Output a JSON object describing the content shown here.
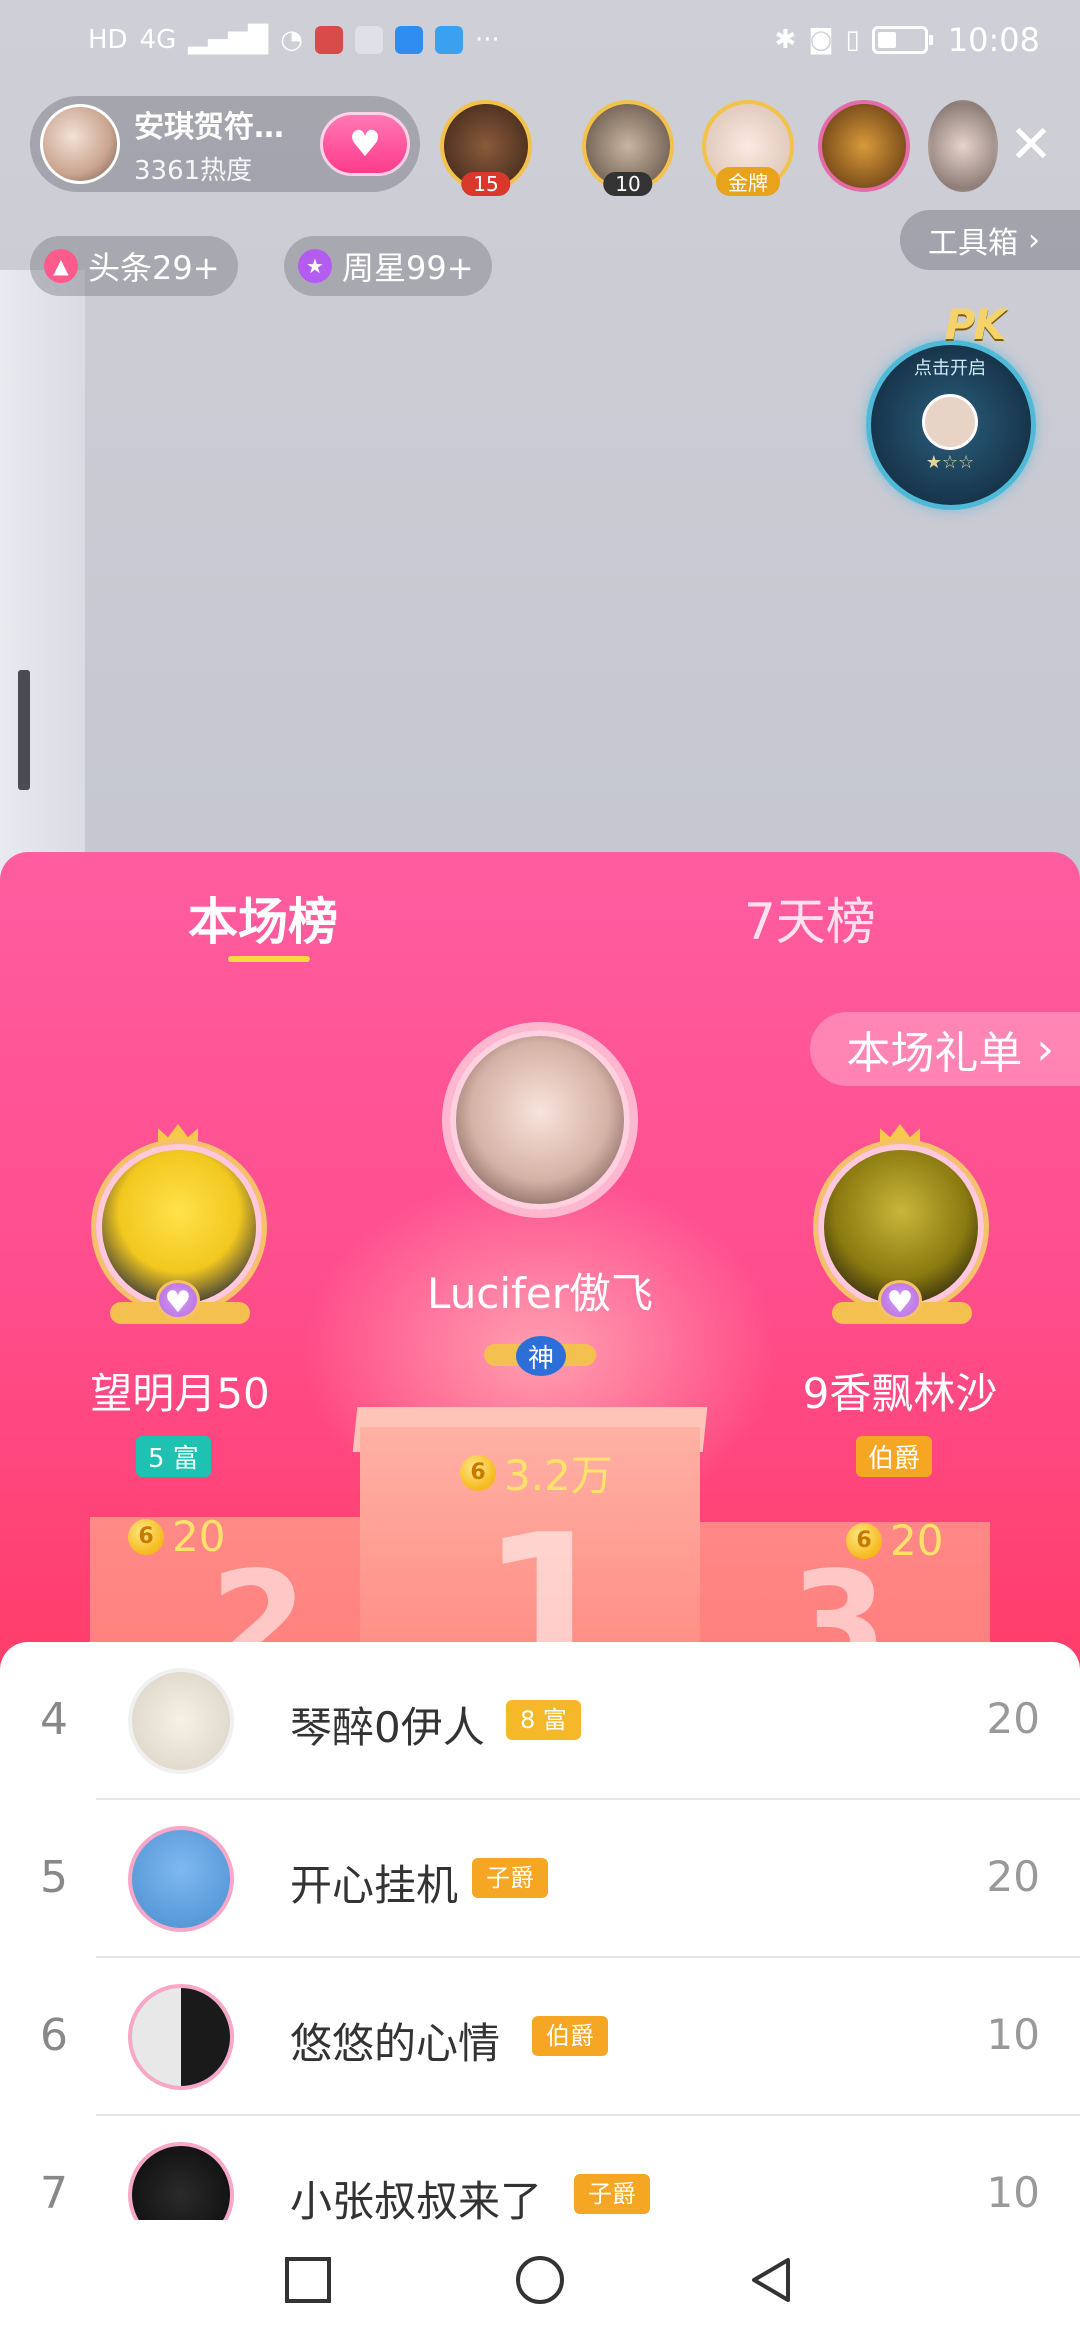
{
  "status_bar": {
    "left_text": "HD",
    "network": "4G",
    "time": "10:08"
  },
  "host": {
    "name": "安琪贺符…",
    "heat": "3361热度"
  },
  "viewers": [
    {
      "badge": "15"
    },
    {
      "badge": "10"
    },
    {
      "badge": "金牌"
    }
  ],
  "tags": {
    "headline": "头条29+",
    "weekly_star": "周星99+"
  },
  "toolbox_label": "工具箱",
  "pk": {
    "logo": "PK",
    "subtitle": "点击开启",
    "stars": "★☆☆"
  },
  "panel": {
    "tabs": [
      {
        "label": "本场榜",
        "active": true
      },
      {
        "label": "7天榜",
        "active": false
      }
    ],
    "gift_list_label": "本场礼单"
  },
  "podium": {
    "first": {
      "rank": "1",
      "name": "Lucifer傲飞",
      "badge": "神",
      "score": "3.2万"
    },
    "second": {
      "rank": "2",
      "name": "望明月50",
      "badge": "5 富",
      "score": "20"
    },
    "third": {
      "rank": "3",
      "name": "9香飘林沙",
      "badge": "伯爵",
      "score": "20"
    }
  },
  "list": [
    {
      "rank": "4",
      "name": "琴醉0伊人",
      "badge": "8 富",
      "badge_color": "#f5b829",
      "score": "20"
    },
    {
      "rank": "5",
      "name": "开心挂机",
      "badge": "子爵",
      "badge_color": "#f5a623",
      "score": "20"
    },
    {
      "rank": "6",
      "name": "悠悠的心情",
      "badge": "伯爵",
      "badge_color": "#f5a623",
      "score": "10"
    },
    {
      "rank": "7",
      "name": "小张叔叔来了",
      "badge": "子爵",
      "badge_color": "#f5a623",
      "score": "10"
    }
  ],
  "colors": {
    "accent_pink": "#ff4d8c",
    "gold": "#ffe26b"
  }
}
